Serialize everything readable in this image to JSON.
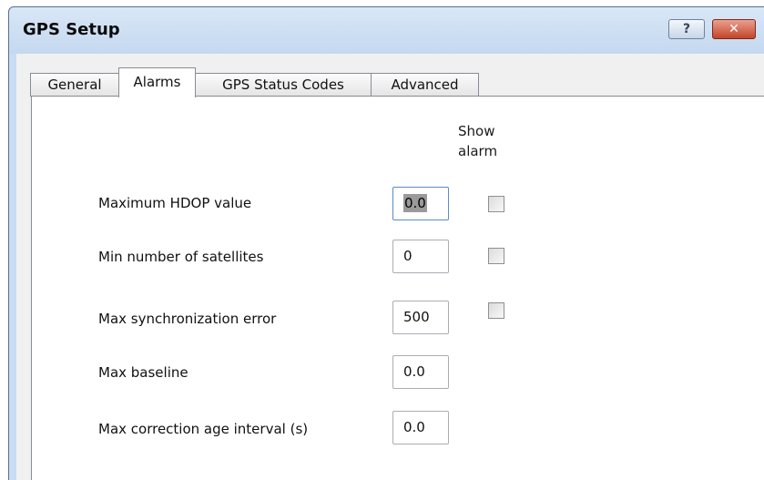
{
  "window": {
    "title": "GPS Setup",
    "help_label": "?",
    "close_label": "✕"
  },
  "tabs": [
    {
      "label": "General",
      "active": false
    },
    {
      "label": "Alarms",
      "active": true
    },
    {
      "label": "GPS Status Codes",
      "active": false
    },
    {
      "label": "Advanced",
      "active": false
    }
  ],
  "alarms": {
    "show_alarm_header_line1": "Show",
    "show_alarm_header_line2": "alarm",
    "rows": [
      {
        "label": "Maximum HDOP value",
        "value": "0.0",
        "show_alarm": false
      },
      {
        "label": "Min number of satellites",
        "value": "0",
        "show_alarm": false
      },
      {
        "label": "Max synchronization error",
        "value": "500",
        "show_alarm": false
      },
      {
        "label": "Max baseline",
        "value": "0.0"
      },
      {
        "label": "Max correction age interval (s)",
        "value": "0.0"
      }
    ]
  },
  "colors": {
    "title_bar": "#c9dcf1",
    "close_button": "#c4432b",
    "client_background": "#f0f0f0",
    "panel_background": "#ffffff"
  }
}
